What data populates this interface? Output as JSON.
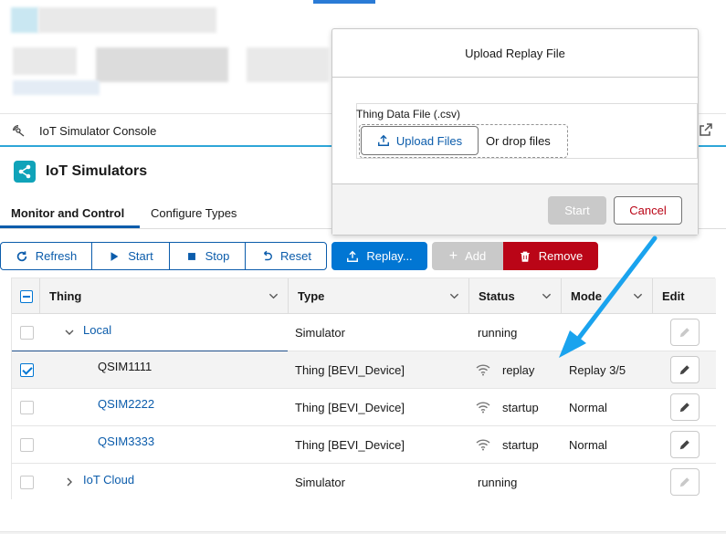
{
  "console": {
    "title": "IoT Simulator Console"
  },
  "app": {
    "title": "IoT Simulators"
  },
  "tabs": [
    {
      "label": "Monitor and Control",
      "active": true
    },
    {
      "label": "Configure Types",
      "active": false
    }
  ],
  "toolbar": {
    "refresh": "Refresh",
    "start": "Start",
    "stop": "Stop",
    "reset": "Reset",
    "replay": "Replay...",
    "add": "Add",
    "remove": "Remove"
  },
  "table": {
    "columns": [
      "Thing",
      "Type",
      "Status",
      "Mode",
      "Edit"
    ],
    "rows": [
      {
        "thing": "Local",
        "type": "Simulator",
        "status": "running",
        "mode": "",
        "selected": false,
        "expanded": true,
        "edit_enabled": false
      },
      {
        "thing": "QSIM1111",
        "type": "Thing [BEVI_Device]",
        "status": "replay",
        "mode": "Replay 3/5",
        "selected": true,
        "edit_enabled": true
      },
      {
        "thing": "QSIM2222",
        "type": "Thing [BEVI_Device]",
        "status": "startup",
        "mode": "Normal",
        "selected": false,
        "edit_enabled": true
      },
      {
        "thing": "QSIM3333",
        "type": "Thing [BEVI_Device]",
        "status": "startup",
        "mode": "Normal",
        "selected": false,
        "edit_enabled": true
      },
      {
        "thing": "IoT Cloud",
        "type": "Simulator",
        "status": "running",
        "mode": "",
        "selected": false,
        "expanded": false,
        "edit_enabled": false
      }
    ]
  },
  "modal": {
    "title": "Upload Replay File",
    "field_label": "Thing Data File (.csv)",
    "upload_button": "Upload Files",
    "drop_text": "Or drop files",
    "start_button": "Start",
    "cancel_button": "Cancel"
  },
  "colors": {
    "brand": "#0176d3",
    "link": "#0b5cab",
    "danger": "#ba0517",
    "app_icon": "#10a3b9",
    "annotation_arrow": "#1aa3ee"
  }
}
